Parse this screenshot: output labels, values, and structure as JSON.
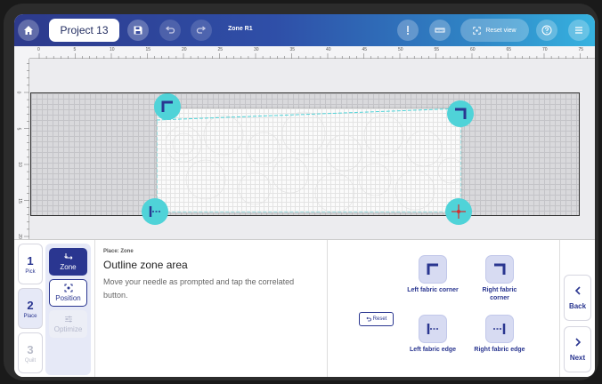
{
  "toolbar": {
    "project_name": "Project 13",
    "zone_label": "Zone R1",
    "reset_view_label": "Reset view",
    "icons": [
      "home-icon",
      "save-icon",
      "undo-icon",
      "redo-icon",
      "needle-icon",
      "ruler-icon",
      "reset-view-icon",
      "help-icon",
      "menu-icon"
    ]
  },
  "rulers": {
    "top_ticks": [
      "0",
      "5",
      "10",
      "15",
      "20",
      "25",
      "30",
      "35",
      "40",
      "45",
      "50",
      "55",
      "60",
      "65",
      "70",
      "75"
    ],
    "left_ticks": [
      "0",
      "5",
      "10",
      "15",
      "20"
    ]
  },
  "steps": [
    {
      "num": "1",
      "label": "Pick",
      "state": "normal"
    },
    {
      "num": "2",
      "label": "Place",
      "state": "active"
    },
    {
      "num": "3",
      "label": "Quilt",
      "state": "inactive"
    }
  ],
  "substeps": [
    {
      "label": "Zone",
      "state": "selected"
    },
    {
      "label": "Position",
      "state": "normal"
    },
    {
      "label": "Optimize",
      "state": "disabled"
    }
  ],
  "instructions": {
    "heading": "Place: Zone",
    "title": "Outline zone area",
    "body": "Move your needle as prompted and tap the correlated button."
  },
  "reset_label": "Reset",
  "corner_buttons": {
    "left_corner": "Left fabric corner",
    "right_corner": "Right fabric corner",
    "left_edge": "Left fabric edge",
    "right_edge": "Right fabric edge"
  },
  "nav": {
    "back": "Back",
    "next": "Next"
  },
  "colors": {
    "primary": "#2a3690",
    "accent_cyan": "#4fd3d8",
    "marker_red": "#d32f2f"
  }
}
